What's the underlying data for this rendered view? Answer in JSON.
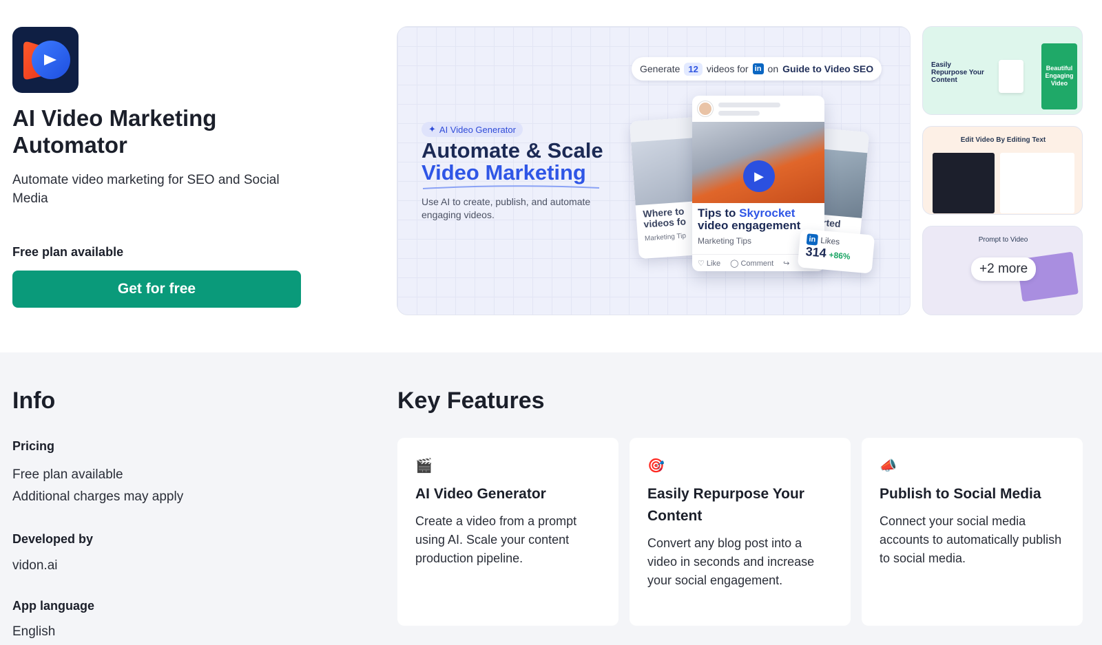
{
  "app": {
    "title": "AI Video Marketing Automator",
    "tagline": "Automate video marketing for SEO and Social Media",
    "plan_label": "Free plan available",
    "cta_label": "Get for free"
  },
  "hero": {
    "generate_prefix": "Generate",
    "generate_count": "12",
    "generate_mid": "videos for",
    "generate_on": "on",
    "generate_target": "Guide to Video SEO",
    "tag": "AI Video Generator",
    "headline_1": "Automate & Scale",
    "headline_2": "Video Marketing",
    "subtext": "Use AI to create, publish, and automate engaging videos.",
    "post_title_plain": "Tips to ",
    "post_title_highlight": "Skyrocket",
    "post_title_line2": "video engagement",
    "post_category": "Marketing Tips",
    "action_like": "Like",
    "action_comment": "Comment",
    "likes_label": "Likes",
    "likes_count": "314",
    "likes_delta": "+86%",
    "back_left_title": "Where to videos fo",
    "back_left_cat": "Marketing Tip",
    "back_right_title": "arted"
  },
  "thumbnails": {
    "t1_title": "Easily Repurpose Your Content",
    "t1_right": "Beautiful Engaging Video",
    "t2_title": "Edit Video By Editing Text",
    "t3_title": "Prompt to Video",
    "more": "+2 more"
  },
  "info": {
    "heading": "Info",
    "pricing_label": "Pricing",
    "pricing_line1": "Free plan available",
    "pricing_line2": "Additional charges may apply",
    "developer_label": "Developed by",
    "developer": "vidon.ai",
    "language_label": "App language",
    "language": "English"
  },
  "features": {
    "heading": "Key Features",
    "items": [
      {
        "emoji": "🎬",
        "title": "AI Video Generator",
        "desc": "Create a video from a prompt using AI. Scale your content production pipeline."
      },
      {
        "emoji": "🎯",
        "title": "Easily Repurpose Your Content",
        "desc": "Convert any blog post into a video in seconds and increase your social engagement."
      },
      {
        "emoji": "📣",
        "title": "Publish to Social Media",
        "desc": "Connect your social media accounts to automatically publish to social media."
      }
    ]
  },
  "colors": {
    "cta": "#0a9a7a",
    "accent_blue": "#2f56e6",
    "section_bg": "#f4f5f8"
  }
}
